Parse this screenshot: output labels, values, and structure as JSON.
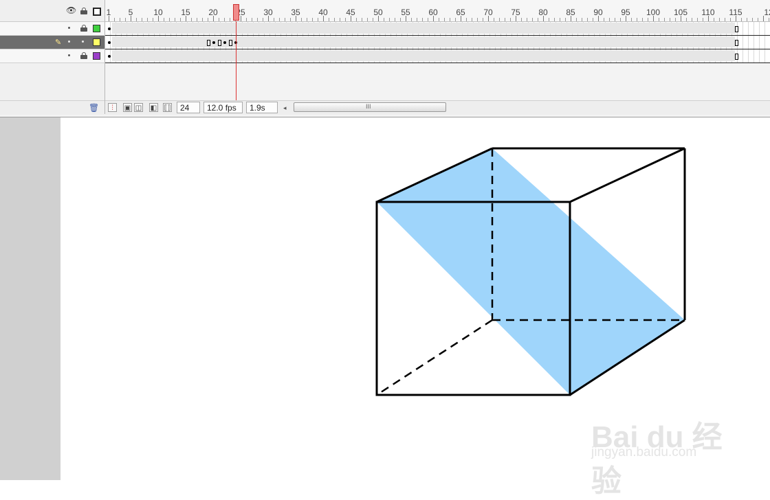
{
  "timeline": {
    "frame_labels": [
      "1",
      "5",
      "10",
      "15",
      "20",
      "25",
      "30",
      "35",
      "40",
      "45",
      "50",
      "55",
      "60",
      "65",
      "70",
      "75",
      "80",
      "85",
      "90",
      "95",
      "100",
      "105",
      "110",
      "115",
      "12"
    ],
    "current_frame": "24",
    "frame_rate": "12.0 fps",
    "elapsed_time": "1.9s",
    "scroll_grip": "III",
    "layer_swatch_colors": [
      "#3fd13f",
      "#ffff66",
      "#9b3fc9"
    ],
    "header_icons": [
      "eye-icon",
      "lock-icon",
      "outline-icon"
    ]
  },
  "stage": {
    "shaded_color": "#9fd5fb",
    "edge_color": "#000000"
  },
  "watermark": {
    "brand": "Bai du 经验",
    "url": "jingyan.baidu.com"
  }
}
